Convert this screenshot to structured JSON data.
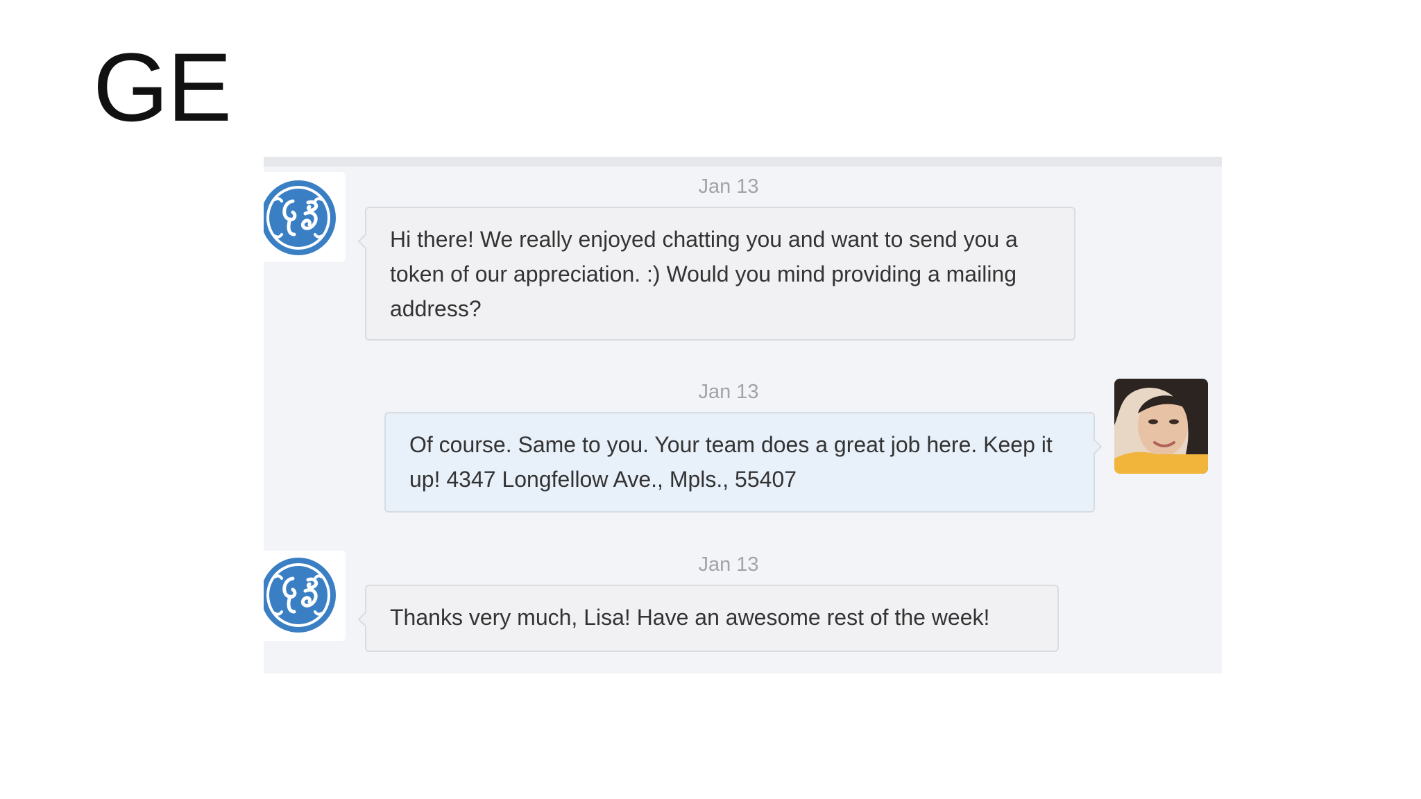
{
  "slide": {
    "title": "GE"
  },
  "chat": {
    "messages": [
      {
        "sender": "GE",
        "direction": "incoming",
        "date": "Jan 13",
        "text": "Hi there! We really enjoyed chatting you and want to send you a token of our appreciation. :) Would you mind providing a mailing address?",
        "avatar": "ge-logo-icon"
      },
      {
        "sender": "Lisa",
        "direction": "outgoing",
        "date": "Jan 13",
        "text": "Of course. Same to you. Your team does a great job here. Keep it up! 4347 Longfellow Ave., Mpls., 55407",
        "avatar": "user-photo-avatar"
      },
      {
        "sender": "GE",
        "direction": "incoming",
        "date": "Jan 13",
        "text": "Thanks very much, Lisa! Have an awesome rest of the week!",
        "avatar": "ge-logo-icon"
      }
    ]
  },
  "colors": {
    "ge_blue": "#3a7fc4",
    "incoming_bubble": "#f1f1f3",
    "outgoing_bubble": "#e8f0f9",
    "panel_background": "#f2f4f7",
    "timestamp_text": "#a0a3a8"
  }
}
